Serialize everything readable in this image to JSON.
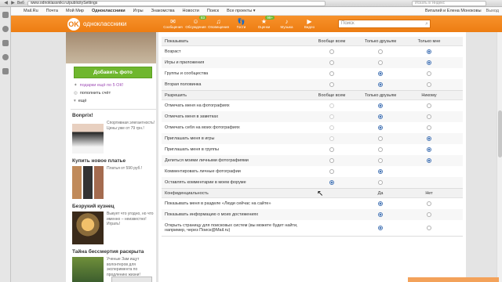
{
  "browser": {
    "tab": "Веб",
    "url": "www.odnoklassniki.ru/publicitySettings",
    "search_placeholder": "Искать в Яндекс"
  },
  "topbar": {
    "links": [
      "Mail.Ru",
      "Почта",
      "Мой Мир",
      "Одноклассники",
      "Игры",
      "Знакомства",
      "Новости",
      "Поиск",
      "Все проекты ▾"
    ],
    "user": "Виталий и Елена Моноковы",
    "exit": "Выход"
  },
  "header": {
    "logo_text": "одноклассники",
    "nav": [
      {
        "label": "Сообщения",
        "icon": "✉"
      },
      {
        "label": "Обсуждения",
        "icon": "☺",
        "badge": "83"
      },
      {
        "label": "Оповещения",
        "icon": "♫"
      },
      {
        "label": "Гости",
        "icon": "👣"
      },
      {
        "label": "Оценки",
        "icon": "★",
        "badge": "99+"
      },
      {
        "label": "Музыка",
        "icon": "♪"
      },
      {
        "label": "Видео",
        "icon": "▶"
      }
    ],
    "search_placeholder": "Поиск"
  },
  "left": {
    "add_photo": "Добавить фото",
    "menu": [
      {
        "icon": "✦",
        "label": "подарки ещё по 5 ОК!",
        "accent": true
      },
      {
        "icon": "◎",
        "label": "пополнить счёт"
      },
      {
        "icon": "▾",
        "label": "ещё"
      }
    ],
    "ads": [
      {
        "title": "Bonprix!",
        "text": "Спортивная элегантность! Цены уже от 79 грн.!",
        "img": "woman"
      },
      {
        "title": "Купить новое платье",
        "text": "Платья от 590 руб.!",
        "img": "dresses"
      },
      {
        "title": "Безрукий кузнец",
        "text": "Выкует что угодно, но что именно – неизвестно! Играть!",
        "img": "smith"
      },
      {
        "title": "Тайна бессмертия раскрыта",
        "text": "Ученые Зам ищут волонтеров для эксперимента по продлению жизни!",
        "img": "nature"
      }
    ]
  },
  "settings": {
    "sections": [
      {
        "header": [
          "Показывать",
          "Вообще всем",
          "Только друзьям",
          "Только мне"
        ],
        "rows": [
          {
            "label": "Возраст",
            "sel": 2
          },
          {
            "label": "Игры и приложения",
            "sel": 2
          },
          {
            "label": "Группы и сообщества",
            "sel": 1
          },
          {
            "label": "Вторая половинка",
            "sel": 1
          }
        ]
      },
      {
        "header": [
          "Разрешить",
          "Вообще всем",
          "Только друзьям",
          "Никому"
        ],
        "rows": [
          {
            "label": "Отмечать меня на фотографиях",
            "sel": 1,
            "dim0": true
          },
          {
            "label": "Отмечать меня в заметках",
            "sel": 1,
            "dim0": true
          },
          {
            "label": "Отмечать себя на моих фотографиях",
            "sel": 1,
            "dim0": true
          },
          {
            "label": "Приглашать меня в игры",
            "sel": 2,
            "dim0": true
          },
          {
            "label": "Приглашать меня в группы",
            "sel": 2
          },
          {
            "label": "Делиться моими личными фотографиями",
            "sel": 2
          },
          {
            "label": "Комментировать личные фотографии",
            "sel": 1,
            "none2": true
          },
          {
            "label": "Оставлять комментарии в моем форуме",
            "sel": 0,
            "none2": true
          }
        ]
      },
      {
        "header": [
          "Конфиденциальность",
          "",
          "Да",
          "Нет"
        ],
        "rows": [
          {
            "label": "Показывать меня в разделе «Люди сейчас на сайте»",
            "sel": 1,
            "binary": true
          },
          {
            "label": "Показывать информацию о моих достижениях",
            "sel": 1,
            "binary": true
          },
          {
            "label": "Открыть страницу для поисковых систем (вы можете будет найти, например, через Поиск@Mail.ru)",
            "sel": 1,
            "binary": true,
            "tall": true
          }
        ]
      }
    ]
  }
}
